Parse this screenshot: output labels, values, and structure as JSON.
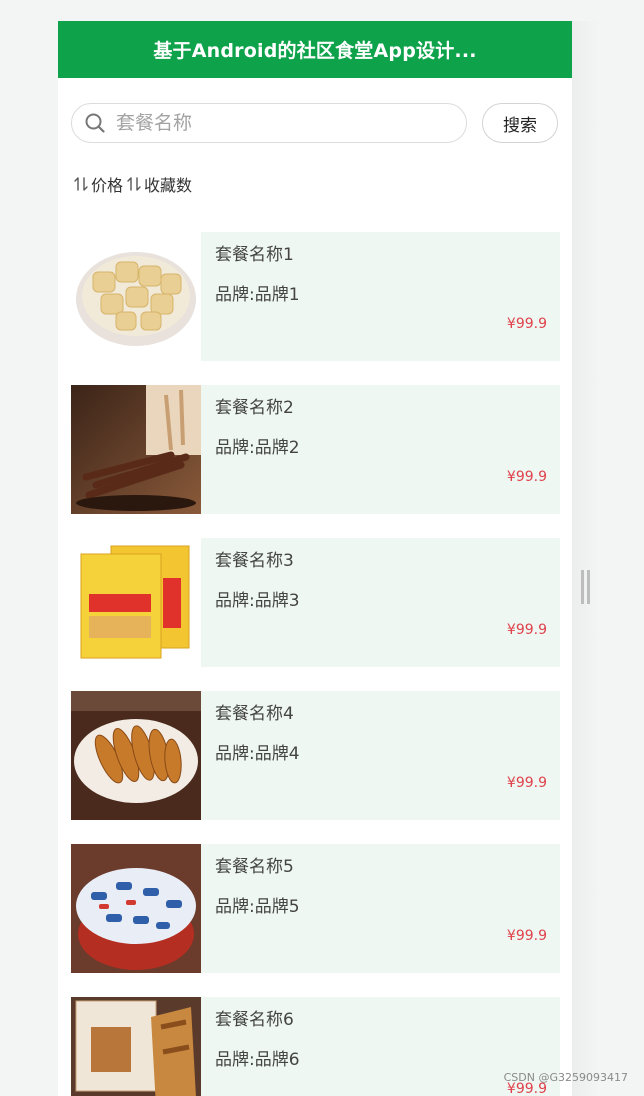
{
  "header": {
    "title": "基于Android的社区食堂App设计..."
  },
  "search": {
    "placeholder": "套餐名称",
    "value": "",
    "button_label": "搜索"
  },
  "sort": {
    "price_label": "价格",
    "favorites_label": "收藏数"
  },
  "items": [
    {
      "name": "套餐名称1",
      "brand": "品牌:品牌1",
      "price": "¥99.9",
      "image": "cookie-bowl-image"
    },
    {
      "name": "套餐名称2",
      "brand": "品牌:品牌2",
      "price": "¥99.9",
      "image": "dried-beef-image"
    },
    {
      "name": "套餐名称3",
      "brand": "品牌:品牌3",
      "price": "¥99.9",
      "image": "biscuit-pack-image"
    },
    {
      "name": "套餐名称4",
      "brand": "品牌:品牌4",
      "price": "¥99.9",
      "image": "fried-fish-plate-image"
    },
    {
      "name": "套餐名称5",
      "brand": "品牌:品牌5",
      "price": "¥99.9",
      "image": "candy-bowl-image"
    },
    {
      "name": "套餐名称6",
      "brand": "品牌:品牌6",
      "price": "¥99.9",
      "image": "snack-pack-image"
    }
  ],
  "watermark": "CSDN @G3259093417",
  "colors": {
    "header": "#0ea24a",
    "price": "#e0424d",
    "card": "#eef7f1"
  }
}
